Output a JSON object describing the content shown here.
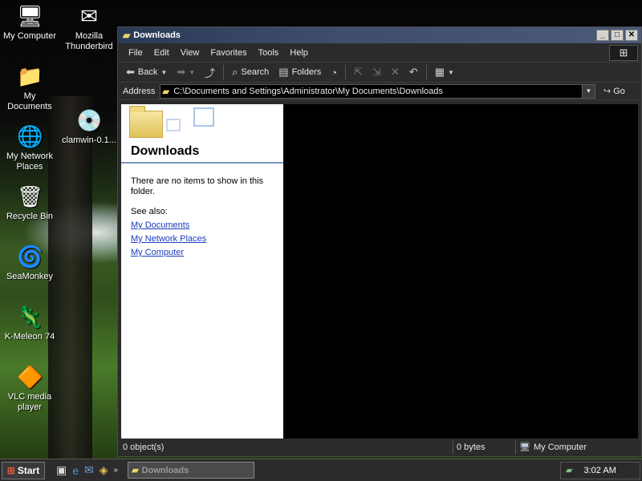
{
  "desktop": {
    "icons": [
      {
        "label": "My Computer",
        "icon": "my-computer-icon",
        "glyph": "🖥"
      },
      {
        "label": "Mozilla Thunderbird",
        "icon": "thunderbird-icon",
        "glyph": "✉"
      },
      {
        "label": "My Documents",
        "icon": "my-documents-icon",
        "glyph": "📁"
      },
      {
        "label": "clamwin-0.1...",
        "icon": "installer-icon",
        "glyph": "💿"
      },
      {
        "label": "My Network Places",
        "icon": "network-places-icon",
        "glyph": "🌐"
      },
      {
        "label": "Recycle Bin",
        "icon": "recycle-bin-icon",
        "glyph": "🗑"
      },
      {
        "label": "SeaMonkey",
        "icon": "seamonkey-icon",
        "glyph": "🌀"
      },
      {
        "label": "K-Meleon 74",
        "icon": "kmeleon-icon",
        "glyph": "🦎"
      },
      {
        "label": "VLC media player",
        "icon": "vlc-icon",
        "glyph": "🔶"
      }
    ]
  },
  "window": {
    "title": "Downloads",
    "controls": {
      "minimize": "_",
      "maximize": "□",
      "close": "✕"
    },
    "menu": [
      "File",
      "Edit",
      "View",
      "Favorites",
      "Tools",
      "Help"
    ],
    "toolbar": {
      "back": "Back",
      "search": "Search",
      "folders": "Folders"
    },
    "address": {
      "label": "Address",
      "value": "C:\\Documents and Settings\\Administrator\\My Documents\\Downloads",
      "go": "Go"
    },
    "taskpane": {
      "title": "Downloads",
      "message": "There are no items to show in this folder.",
      "see_also": "See also:",
      "links": [
        "My Documents",
        "My Network Places",
        "My Computer"
      ]
    },
    "status": {
      "objects": "0 object(s)",
      "size": "0 bytes",
      "zone": "My Computer"
    }
  },
  "taskbar": {
    "start": "Start",
    "task": "Downloads",
    "clock": "3:02 AM"
  }
}
